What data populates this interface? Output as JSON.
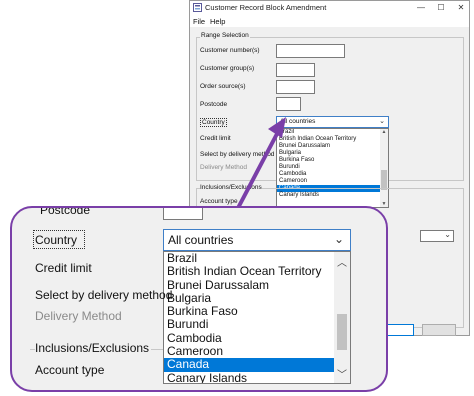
{
  "window": {
    "title": "Customer Record Block Amendment",
    "controls": {
      "minimize": "—",
      "maximize": "☐",
      "close": "✕"
    },
    "menu": [
      "File",
      "Help"
    ]
  },
  "range": {
    "legend": "Range Selection",
    "customer_numbers": "Customer number(s)",
    "customer_groups": "Customer group(s)",
    "order_sources": "Order source(s)",
    "postcode": "Postcode",
    "country": "Country",
    "credit_limit": "Credit limit",
    "select_by_delivery": "Select by delivery method",
    "delivery_method": "Delivery Method"
  },
  "inclusions": {
    "legend": "Inclusions/Exclusions",
    "account_type": "Account type"
  },
  "country_combo": {
    "selected": "All countries",
    "options": [
      "Brazil",
      "British Indian Ocean Territory",
      "Brunei Darussalam",
      "Bulgaria",
      "Burkina Faso",
      "Burundi",
      "Cambodia",
      "Cameroon",
      "Canada",
      "Canary Islands"
    ],
    "highlighted": "Canada"
  },
  "zoom": {
    "partial_label": "Postcode"
  },
  "colors": {
    "accent": "#0078d7",
    "callout": "#7a3fa8"
  }
}
